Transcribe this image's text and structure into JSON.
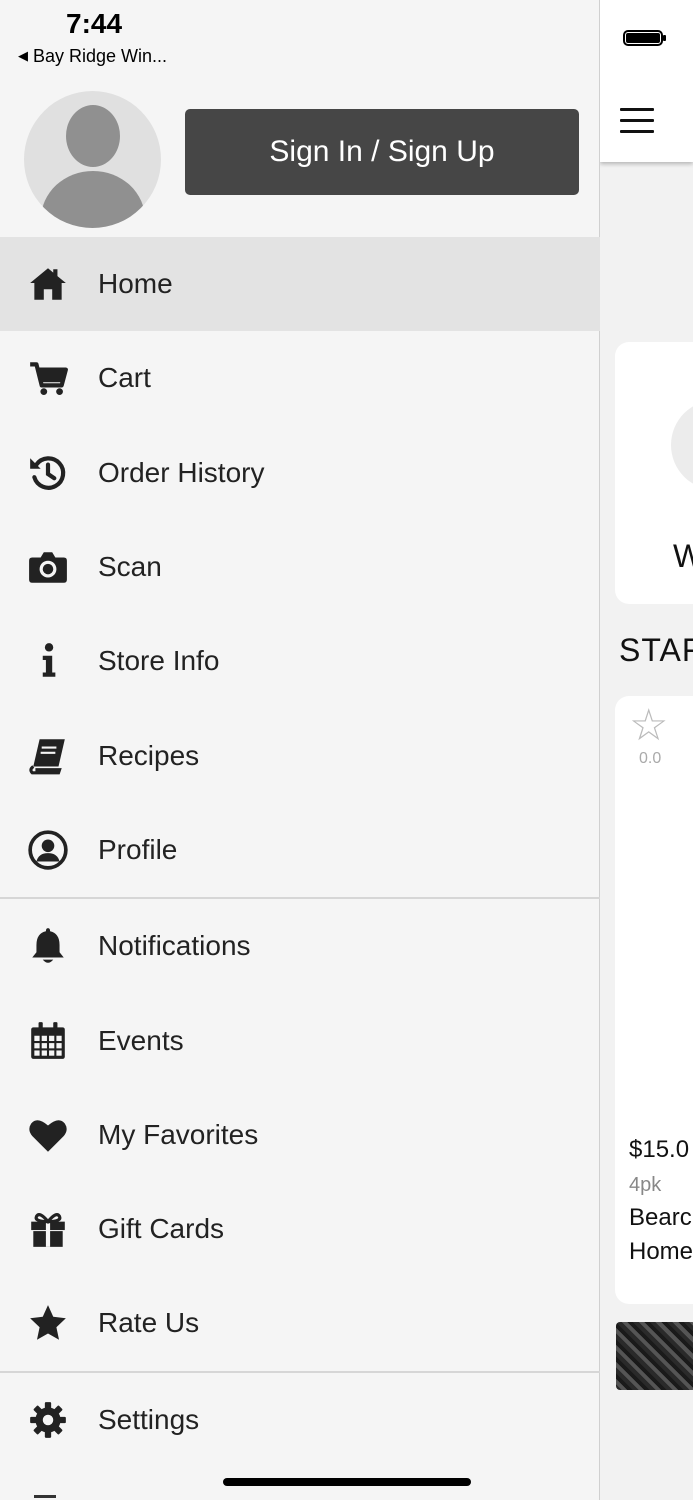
{
  "status_bar": {
    "time": "7:44",
    "back_label": "Bay Ridge Win..."
  },
  "profile": {
    "signin_label": "Sign In / Sign Up"
  },
  "menu": {
    "items": [
      {
        "label": "Home",
        "icon": "home-icon",
        "active": true
      },
      {
        "label": "Cart",
        "icon": "cart-icon"
      },
      {
        "label": "Order History",
        "icon": "history-icon"
      },
      {
        "label": "Scan",
        "icon": "camera-icon"
      },
      {
        "label": "Store Info",
        "icon": "info-icon"
      },
      {
        "label": "Recipes",
        "icon": "book-icon"
      },
      {
        "label": "Profile",
        "icon": "user-circle-icon"
      },
      {
        "label": "Notifications",
        "icon": "bell-icon"
      },
      {
        "label": "Events",
        "icon": "calendar-icon"
      },
      {
        "label": "My Favorites",
        "icon": "heart-icon"
      },
      {
        "label": "Gift Cards",
        "icon": "gift-icon"
      },
      {
        "label": "Rate Us",
        "icon": "star-icon"
      },
      {
        "label": "Settings",
        "icon": "gear-icon"
      }
    ]
  },
  "background": {
    "card_letter": "W",
    "section_title": "STAF",
    "product": {
      "rating": "0.0",
      "price": "$15.0",
      "pack": "4pk",
      "name_line1": "Bearc",
      "name_line2": "Home"
    }
  },
  "colors": {
    "signin_button": "#464646",
    "active_row": "#e3e3e3",
    "drawer_bg": "#f5f5f5"
  }
}
